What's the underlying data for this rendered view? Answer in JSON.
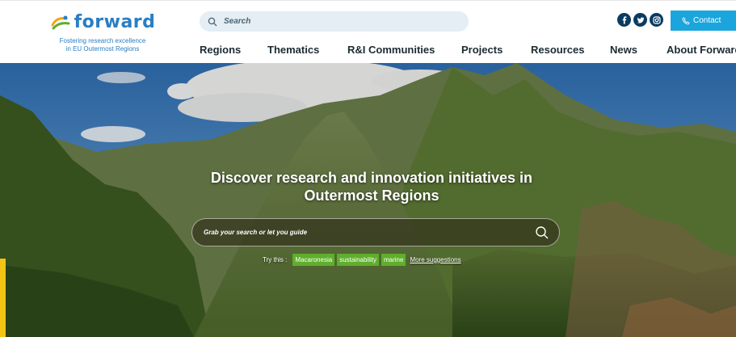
{
  "header": {
    "logo": {
      "word": "forward",
      "tagline": "Fostering research excellence\nin EU Outermost Regions"
    },
    "search": {
      "placeholder": "Search"
    },
    "socials": [
      "facebook-icon",
      "twitter-icon",
      "instagram-icon"
    ],
    "contact_label": "Contact"
  },
  "nav": {
    "items": [
      {
        "label": "Regions"
      },
      {
        "label": "Thematics"
      },
      {
        "label": "R&I Communities"
      },
      {
        "label": "Projects"
      },
      {
        "label": "Resources"
      },
      {
        "label": "News"
      },
      {
        "label": "About Forward"
      }
    ]
  },
  "hero": {
    "headline": "Discover research and innovation initiatives in\nOutermost Regions",
    "search_placeholder": "Grab your search or let you guide",
    "try_label": "Try this :",
    "tags": [
      "Macaronesia",
      "sustainability",
      "marine"
    ],
    "more_label": "More suggestions"
  },
  "colors": {
    "brand_blue": "#2a7ec4",
    "contact_button": "#1aa5dc",
    "social_icons": "#0a3c62",
    "tag_green": "#5fae2c",
    "accent_yellow": "#f2c416"
  }
}
